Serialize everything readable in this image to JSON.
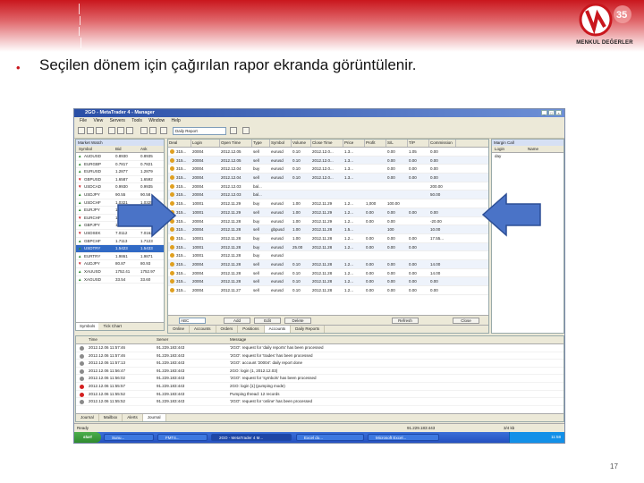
{
  "slide": {
    "bullet": "•",
    "heading": "Seçilen dönem için çağırılan rapor ekranda görüntülenir.",
    "page_number": "17",
    "logo_number": "35",
    "logo_text": "MENKUL DEĞERLER",
    "brand_color": "#c9161d"
  },
  "app": {
    "title": "2GO - MetaTrader 4 - Manager",
    "menu": [
      "File",
      "View",
      "Servers",
      "Tools",
      "Window",
      "Help"
    ],
    "report_select": "Daily Report"
  },
  "market_watch": {
    "title": "Market Watch",
    "columns": [
      "Symbol",
      "Bid",
      "Ask"
    ],
    "rows": [
      {
        "symbol": "AUDUSD",
        "bid": "0.8930",
        "ask": "0.8935",
        "arrow": "up"
      },
      {
        "symbol": "EURGBP",
        "bid": "0.7817",
        "ask": "0.7821",
        "arrow": "up"
      },
      {
        "symbol": "EURUSD",
        "bid": "1.2877",
        "ask": "1.2879",
        "arrow": "up"
      },
      {
        "symbol": "GBPUSD",
        "bid": "1.6587",
        "ask": "1.6592",
        "arrow": "down"
      },
      {
        "symbol": "USDCAD",
        "bid": "0.9930",
        "ask": "0.9935",
        "arrow": "down"
      },
      {
        "symbol": "USDJPY",
        "bid": "90.55",
        "ask": "90.58",
        "arrow": "up"
      },
      {
        "symbol": "USDCHF",
        "bid": "1.0321",
        "ask": "1.0325",
        "arrow": "up"
      },
      {
        "symbol": "EURJPY",
        "bid": "116.61",
        "ask": "116.65",
        "arrow": "up"
      },
      {
        "symbol": "EURCHF",
        "bid": "1.3291",
        "ask": "1.3295",
        "arrow": "down"
      },
      {
        "symbol": "GBPJPY",
        "bid": "150.20",
        "ask": "150.26",
        "arrow": "up"
      },
      {
        "symbol": "USDSEK",
        "bid": "7.0112",
        "ask": "7.0162",
        "arrow": "down"
      },
      {
        "symbol": "GBPCHF",
        "bid": "1.7113",
        "ask": "1.7123",
        "arrow": "up"
      },
      {
        "symbol": "USDTRY",
        "bid": "1.5423",
        "ask": "1.5433",
        "arrow": "up"
      },
      {
        "symbol": "EURTRY",
        "bid": "1.9861",
        "ask": "1.9871",
        "arrow": "up"
      },
      {
        "symbol": "AUDJPY",
        "bid": "80.87",
        "ask": "80.93",
        "arrow": "down"
      },
      {
        "symbol": "XAUUSD",
        "bid": "1752.41",
        "ask": "1752.97",
        "arrow": "up"
      },
      {
        "symbol": "XAGUSD",
        "bid": "33.54",
        "ask": "33.60",
        "arrow": "up"
      }
    ],
    "selected_index": 12,
    "tabs": [
      "Symbols",
      "Tick Chart"
    ]
  },
  "trades": {
    "columns": [
      "Deal",
      "Login",
      "Open Time",
      "Type",
      "Symbol",
      "Volume",
      "Close Time",
      "Price",
      "Profit",
      "S/L",
      "T/P",
      "Commission"
    ],
    "rows": [
      [
        "315...",
        "20004",
        "2012.12.05",
        "sell",
        "eurusd",
        "0.10",
        "2012.12.0...",
        "1.3...",
        "",
        "0.00",
        "1.05",
        "0.00"
      ],
      [
        "315...",
        "20004",
        "2012.12.05",
        "sell",
        "eurusd",
        "0.10",
        "2012.12.0...",
        "1.3...",
        "",
        "0.00",
        "0.00",
        "0.00"
      ],
      [
        "315...",
        "20004",
        "2012.12.04",
        "buy",
        "eurusd",
        "0.10",
        "2012.12.0...",
        "1.3...",
        "",
        "0.00",
        "0.00",
        "0.00"
      ],
      [
        "315...",
        "20004",
        "2012.12.04",
        "sell",
        "eurusd",
        "0.10",
        "2012.12.0...",
        "1.3...",
        "",
        "0.00",
        "0.00",
        "0.00"
      ],
      [
        "315...",
        "20004",
        "2012.12.03",
        "bal...",
        "",
        "",
        "",
        "",
        "",
        "",
        "",
        "200.00"
      ],
      [
        "315...",
        "20004",
        "2012.12.03",
        "bal...",
        "",
        "",
        "",
        "",
        "",
        "",
        "",
        "50.00"
      ],
      [
        "315...",
        "10001",
        "2012.11.29",
        "buy",
        "eurusd",
        "1.00",
        "2012.11.29",
        "1.2...",
        "1,000",
        "100.00",
        "",
        ""
      ],
      [
        "315...",
        "10001",
        "2012.11.29",
        "sell",
        "eurusd",
        "1.00",
        "2012.11.29",
        "1.2...",
        "0.00",
        "0.00",
        "0.00",
        "0.00"
      ],
      [
        "315...",
        "20004",
        "2012.11.28",
        "buy",
        "eurusd",
        "1.00",
        "2012.11.29",
        "1.2...",
        "0.00",
        "0.00",
        "",
        "-20.00"
      ],
      [
        "315...",
        "20004",
        "2012.11.28",
        "sell",
        "gbpusd",
        "1.00",
        "2012.11.28",
        "1.5...",
        "",
        "100",
        "",
        "10.00"
      ],
      [
        "315...",
        "10001",
        "2012.11.28",
        "buy",
        "eurusd",
        "1.00",
        "2012.11.28",
        "1.2...",
        "0.00",
        "0.00",
        "0.00",
        "17.55..."
      ],
      [
        "315...",
        "10001",
        "2012.11.28",
        "buy",
        "eurusd",
        "25.00",
        "2012.11.28",
        "1.2...",
        "0.00",
        "0.00",
        "0.00",
        ""
      ],
      [
        "315...",
        "10001",
        "2012.11.28",
        "buy",
        "eurusd",
        "",
        "",
        "",
        "",
        "",
        "",
        ""
      ],
      [
        "315...",
        "20004",
        "2012.11.28",
        "sell",
        "eurusd",
        "0.10",
        "2012.11.28",
        "1.2...",
        "0.00",
        "0.00",
        "0.00",
        "14.00"
      ],
      [
        "315...",
        "20004",
        "2012.11.28",
        "sell",
        "eurusd",
        "0.10",
        "2012.11.28",
        "1.2...",
        "0.00",
        "0.00",
        "0.00",
        "14.00"
      ],
      [
        "315...",
        "20004",
        "2012.11.28",
        "sell",
        "eurusd",
        "0.10",
        "2012.11.28",
        "1.2...",
        "0.00",
        "0.00",
        "0.00",
        "0.00"
      ],
      [
        "315...",
        "20004",
        "2012.11.27",
        "sell",
        "eurusd",
        "0.10",
        "2012.11.28",
        "1.2...",
        "0.00",
        "0.00",
        "0.00",
        "0.00"
      ]
    ],
    "group_select": "ABC",
    "buttons": [
      "Add",
      "Edit",
      "Delete",
      "Refresh",
      "Close"
    ],
    "tabs": [
      "Online",
      "Accounts",
      "Orders",
      "Positions",
      "Accounts",
      "Daily Reports"
    ],
    "active_tab": 4
  },
  "right_panel": {
    "title": "Margin Call",
    "columns": [
      "Login",
      "Name"
    ],
    "first_row": [
      "day",
      ""
    ]
  },
  "journal": {
    "columns": [
      "Time",
      "Server",
      "Message"
    ],
    "rows": [
      {
        "time": "2012.12.06 11:57:46",
        "server": "91.229.183:443",
        "msg": "'2GO': request for 'daily reports' has been processed",
        "kind": "info"
      },
      {
        "time": "2012.12.06 11:57:46",
        "server": "91.229.183:443",
        "msg": "'2GO': request for 'trades' has been processed",
        "kind": "info"
      },
      {
        "time": "2012.12.06 11:57:13",
        "server": "91.229.183:443",
        "msg": "'2GO': account '20004': daily report done",
        "kind": "info"
      },
      {
        "time": "2012.12.06 11:56:47",
        "server": "91.229.183:443",
        "msg": "2GO: login (1, 2012.12.03)",
        "kind": "info"
      },
      {
        "time": "2012.12.06 11:56:02",
        "server": "91.229.183:443",
        "msg": "'2GO': request for 'symbols' has been processed",
        "kind": "info"
      },
      {
        "time": "2012.12.06 11:55:57",
        "server": "91.229.183:443",
        "msg": "2GO: login [1] (pumping mode)",
        "kind": "error"
      },
      {
        "time": "2012.12.06 11:55:52",
        "server": "91.229.183:443",
        "msg": "Pumping thread: 12 records",
        "kind": "error"
      },
      {
        "time": "2012.12.06 11:55:52",
        "server": "91.229.183:443",
        "msg": "'2GO': request for 'online' has been processed",
        "kind": "info"
      }
    ],
    "tabs": [
      "Journal",
      "Mailbox",
      "Alerts",
      "Journal"
    ],
    "active_tab": 3
  },
  "status": {
    "left": "Ready",
    "right_a": "91.229.183:443",
    "right_b": "3/4 kb"
  },
  "taskbar": {
    "start": "start",
    "tasks": [
      "Sunu...",
      "FMT4...",
      "2GO - MetaTrader 4 M...",
      "Excel do...",
      "Microsoft Excel..."
    ],
    "active_task": 2,
    "clock": "11:58"
  },
  "arrow_color": "#4a73c7"
}
